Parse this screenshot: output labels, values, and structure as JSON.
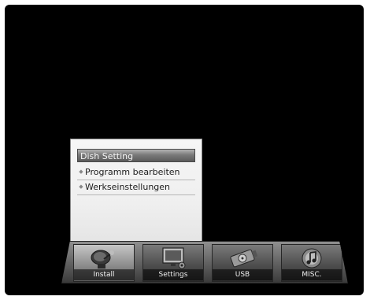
{
  "submenu": {
    "items": [
      {
        "label": "Dish Setting",
        "selected": true
      },
      {
        "label": "Programm bearbeiten",
        "selected": false
      },
      {
        "label": "Werkseinstellungen",
        "selected": false
      }
    ]
  },
  "menubar": {
    "items": [
      {
        "label": "Install",
        "icon": "satellite-dish-icon",
        "active": true
      },
      {
        "label": "Settings",
        "icon": "monitor-settings-icon",
        "active": false
      },
      {
        "label": "USB",
        "icon": "usb-drive-icon",
        "active": false
      },
      {
        "label": "MISC.",
        "icon": "speaker-note-icon",
        "active": false
      }
    ]
  },
  "colors": {
    "background": "#000000",
    "submenu_bg": "#f2f2f2",
    "selected_bg": "#7a7a7a",
    "menubar_bg": "#5f5f5f"
  }
}
